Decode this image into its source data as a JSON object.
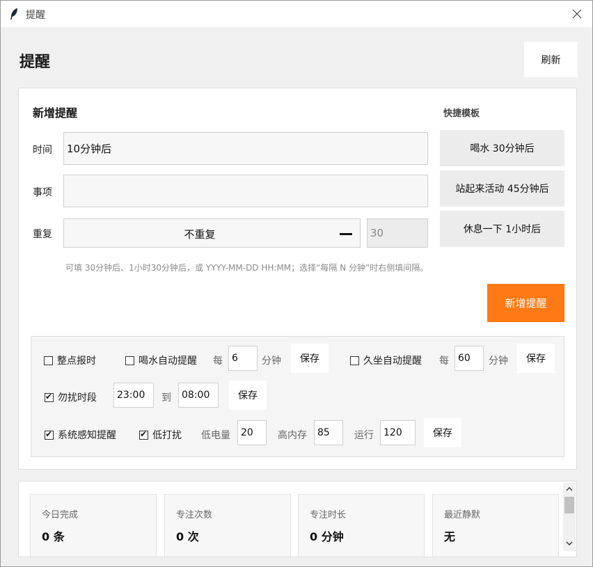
{
  "window": {
    "title": "提醒"
  },
  "header": {
    "title": "提醒",
    "refresh_label": "刷新"
  },
  "new_reminder": {
    "section_title": "新增提醒",
    "time_label": "时间",
    "time_value": "10分钟后",
    "item_label": "事项",
    "item_value": "",
    "repeat_label": "重复",
    "repeat_value": "不重复",
    "interval_value": "30",
    "hint": "可填 30分钟后、1小时30分钟后，或 YYYY-MM-DD HH:MM；选择“每隔 N 分钟”时右侧填间隔。",
    "add_button": "新增提醒"
  },
  "templates": {
    "title": "快捷模板",
    "items": [
      "喝水 30分钟后",
      "站起来活动 45分钟后",
      "休息一下 1小时后"
    ]
  },
  "settings": {
    "hourly_chime": {
      "label": "整点报时",
      "checked": false
    },
    "water": {
      "label": "喝水自动提醒",
      "checked": false,
      "every_label": "每",
      "minutes": "6",
      "unit": "分钟",
      "save": "保存"
    },
    "sitting": {
      "label": "久坐自动提醒",
      "checked": false,
      "every_label": "每",
      "minutes": "60",
      "unit": "分钟",
      "save": "保存"
    },
    "dnd": {
      "label": "勿扰时段",
      "checked": true,
      "start": "23:00",
      "to_label": "到",
      "end": "08:00",
      "save": "保存"
    },
    "system_aware": {
      "label": "系统感知提醒",
      "checked": true
    },
    "low_disturb": {
      "label": "低打扰",
      "checked": true
    },
    "low_battery": {
      "label": "低电量",
      "value": "20"
    },
    "high_memory": {
      "label": "高内存",
      "value": "85"
    },
    "running": {
      "label": "运行",
      "value": "120"
    },
    "save": "保存"
  },
  "stats": [
    {
      "name": "今日完成",
      "value": "0 条"
    },
    {
      "name": "专注次数",
      "value": "0 次"
    },
    {
      "name": "专注时长",
      "value": "0 分钟"
    },
    {
      "name": "最近静默",
      "value": "无"
    }
  ],
  "colors": {
    "accent": "#ff7a15"
  },
  "icons": {
    "app": "feather-icon",
    "close": "close-icon",
    "scroll_up": "chevron-up-icon",
    "scroll_down": "chevron-down-icon"
  }
}
